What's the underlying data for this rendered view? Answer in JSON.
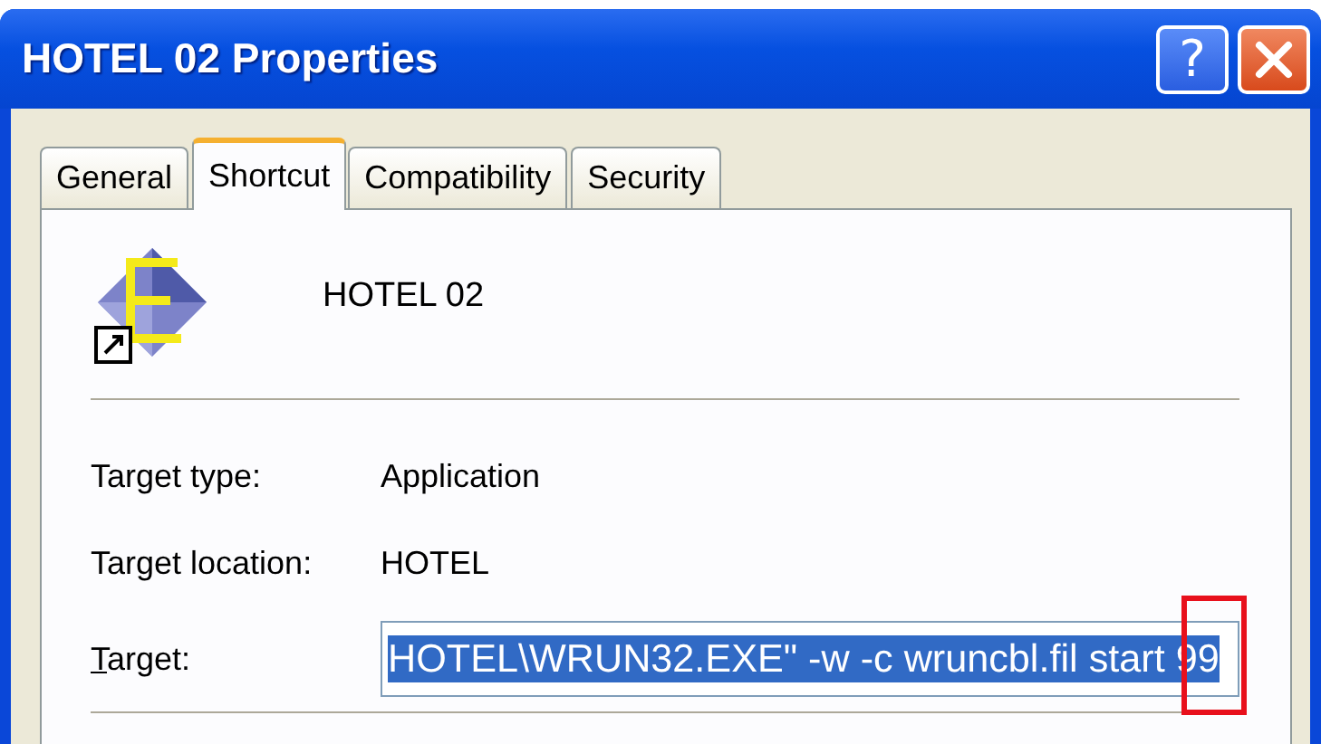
{
  "window": {
    "title": "HOTEL 02 Properties",
    "buttons": [
      {
        "kind": "help",
        "label": "?"
      },
      {
        "kind": "close"
      }
    ]
  },
  "tabs": [
    {
      "label": "General",
      "selected": false
    },
    {
      "label": "Shortcut",
      "selected": true
    },
    {
      "label": "Compatibility",
      "selected": false
    },
    {
      "label": "Security",
      "selected": false
    }
  ],
  "shortcut": {
    "name": "HOTEL 02"
  },
  "fields": [
    {
      "kind": "text",
      "label": "Target type:",
      "value": "Application"
    },
    {
      "kind": "text",
      "label": "Target location:",
      "value": "HOTEL"
    },
    {
      "kind": "input",
      "label": "Target:",
      "first_letter_underlined": true,
      "value": "HOTEL\\WRUN32.EXE\" -w -c wruncbl.fil start 99",
      "selected": true,
      "highlighted": true
    }
  ]
}
